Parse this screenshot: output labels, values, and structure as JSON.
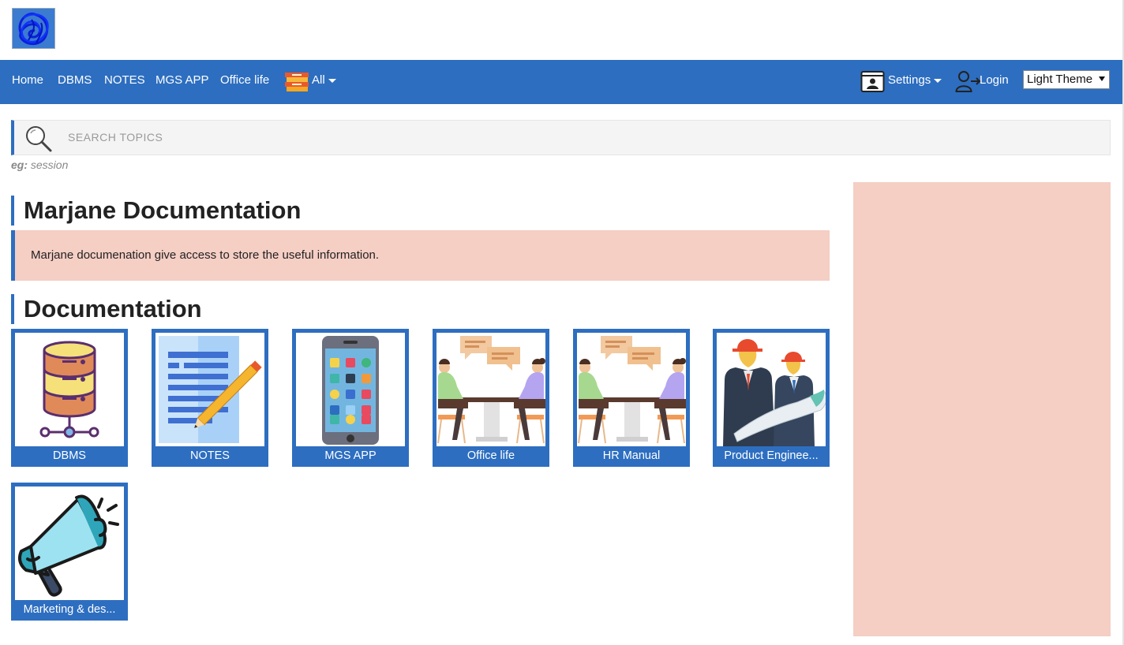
{
  "header": {
    "logo_icon": "blue-scribble-logo-icon"
  },
  "navbar": {
    "links": [
      "Home",
      "DBMS",
      "NOTES",
      "MGS APP",
      "Office life"
    ],
    "all_menu": {
      "label": "All",
      "icon": "books-icon"
    },
    "settings": {
      "label": "Settings",
      "icon": "profile-card-icon"
    },
    "login": {
      "label": "Login",
      "icon": "user-login-icon"
    },
    "theme": {
      "selected": "Light Theme"
    },
    "color": "#2d6ec0"
  },
  "search": {
    "placeholder": "SEARCH TOPICS",
    "hint_prefix": "eg:",
    "hint_example": "session"
  },
  "main": {
    "title": "Marjane Documentation",
    "description": "Marjane documenation give access to store the useful information.",
    "section_title": "Documentation",
    "cards": [
      {
        "label": "DBMS",
        "icon": "database-icon"
      },
      {
        "label": "NOTES",
        "icon": "notes-pencil-icon"
      },
      {
        "label": "MGS APP",
        "icon": "smartphone-apps-icon"
      },
      {
        "label": "Office life",
        "icon": "office-meeting-icon"
      },
      {
        "label": "HR Manual",
        "icon": "office-meeting-icon"
      },
      {
        "label": "Product Enginee...",
        "icon": "engineers-blueprint-icon"
      },
      {
        "label": "Marketing & des...",
        "icon": "megaphone-icon"
      }
    ]
  },
  "colors": {
    "accent": "#2d6ec0",
    "info_background": "#f5cec4"
  }
}
